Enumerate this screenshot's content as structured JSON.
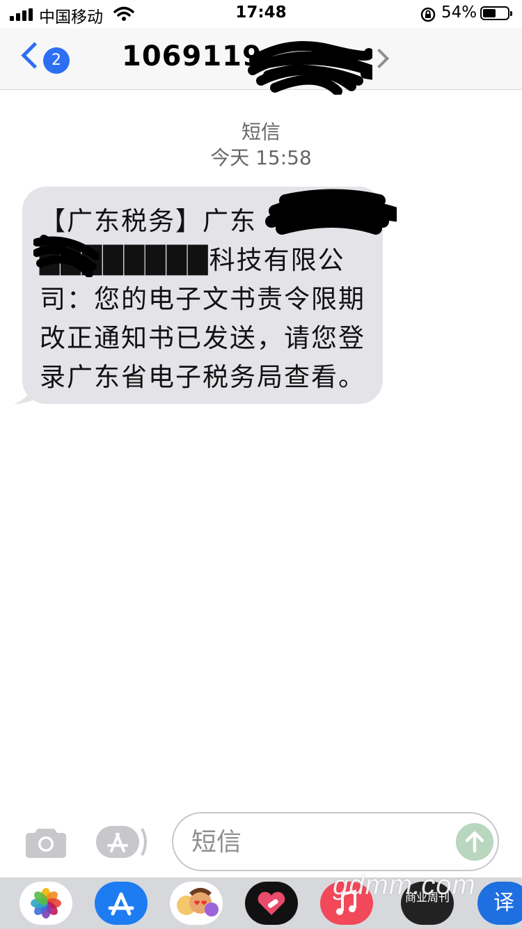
{
  "status_bar": {
    "carrier": "中国移动",
    "time": "17:48",
    "battery": "54%"
  },
  "nav": {
    "back_badge": "2",
    "title": "1069119"
  },
  "conversation": {
    "service": "短信",
    "timestamp": "今天 15:58",
    "message": "【广东税务】广东████████科技有限公司：您的电子文书责令限期改正通知书已发送，请您登录广东省电子税务局查看。"
  },
  "input": {
    "placeholder": "短信"
  },
  "drawer": {
    "apps": [
      "photos-icon",
      "app-store-icon",
      "memoji-icon",
      "heart-app-icon",
      "music-icon",
      "business-weekly-icon",
      "translate-icon"
    ],
    "business_weekly_label": "商业周刊",
    "translate_label": "译",
    "watermark": "gdmm.com"
  },
  "colors": {
    "accent": "#2d6ff3",
    "bubble": "#e4e4e8",
    "send_disabled": "#b9d6bf"
  }
}
